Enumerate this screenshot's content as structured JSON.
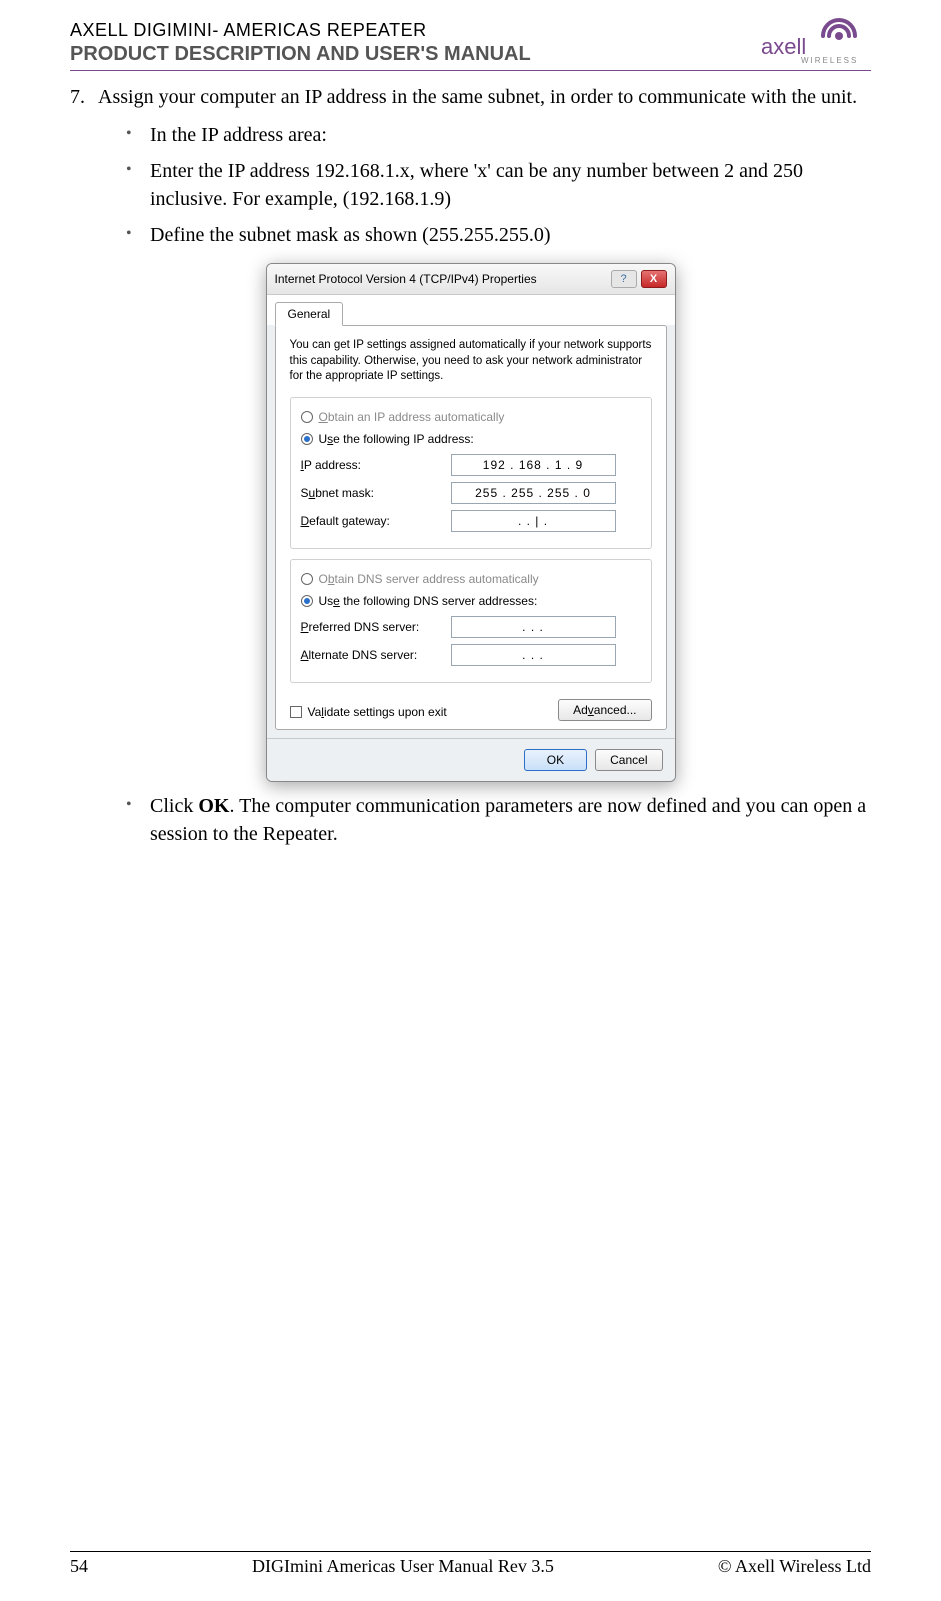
{
  "header": {
    "line1": "AXELL DIGIMINI- AMERICAS REPEATER",
    "line2": "PRODUCT DESCRIPTION AND USER'S MANUAL",
    "logo_brand": "axell",
    "logo_sub": "WIRELESS"
  },
  "step": {
    "num": "7.",
    "text": "Assign your computer an IP address in the same subnet, in order to communicate with the unit."
  },
  "bullets_top": [
    "In the IP address area:",
    "Enter the IP address 192.168.1.x, where 'x' can be any number between 2 and 250 inclusive. For example,  (192.168.1.9)",
    "Define the subnet mask as shown (255.255.255.0)"
  ],
  "dialog": {
    "title": "Internet Protocol Version 4 (TCP/IPv4) Properties",
    "tab": "General",
    "descr": "You can get IP settings assigned automatically if your network supports this capability. Otherwise, you need to ask your network administrator for the appropriate IP settings.",
    "radio_auto_ip": "Obtain an IP address automatically",
    "radio_use_ip": "Use the following IP address:",
    "ip_label": "IP address:",
    "ip_value": "192 . 168 .   1   .   9",
    "subnet_label": "Subnet mask:",
    "subnet_value": "255 . 255 . 255 .   0",
    "gateway_label": "Default gateway:",
    "gateway_value": ".        .    |    .",
    "radio_auto_dns": "Obtain DNS server address automatically",
    "radio_use_dns": "Use the following DNS server addresses:",
    "pref_dns_label": "Preferred DNS server:",
    "pref_dns_value": ".        .        .",
    "alt_dns_label": "Alternate DNS server:",
    "alt_dns_value": ".        .        .",
    "validate": "Validate settings upon exit",
    "advanced": "Advanced...",
    "ok": "OK",
    "cancel": "Cancel"
  },
  "bullet_bottom_pre": "Click ",
  "bullet_bottom_bold": "OK",
  "bullet_bottom_post": ". The computer communication parameters are now defined and you can open a session to the Repeater.",
  "footer": {
    "left": "54",
    "center": "DIGImini Americas User Manual Rev 3.5",
    "right": "© Axell Wireless Ltd"
  }
}
